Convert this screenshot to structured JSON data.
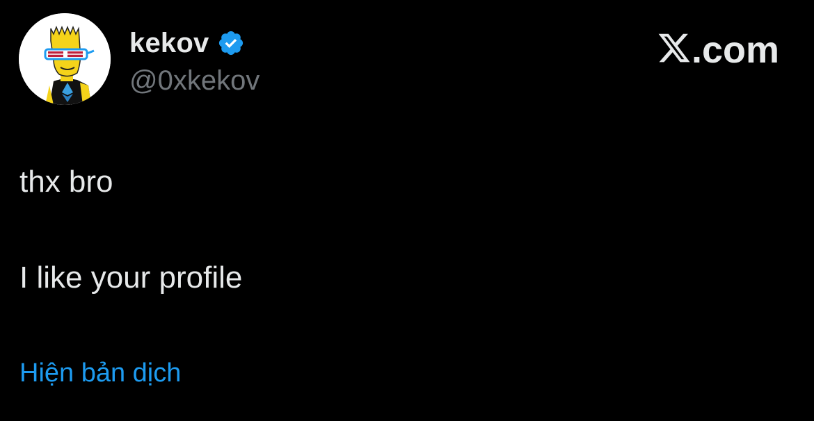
{
  "author": {
    "display_name": "kekov",
    "handle": "@0xkekov",
    "verified": true
  },
  "brand": {
    "label": ".com",
    "icon": "x-logo-icon"
  },
  "tweet": {
    "lines": [
      "thx bro",
      "I like your profile"
    ],
    "translate_link": "Hiện bản dịch"
  },
  "colors": {
    "background": "#000000",
    "text": "#e7e9ea",
    "handle": "#71767b",
    "link": "#1d9bf0",
    "verified": "#1d9bf0"
  }
}
